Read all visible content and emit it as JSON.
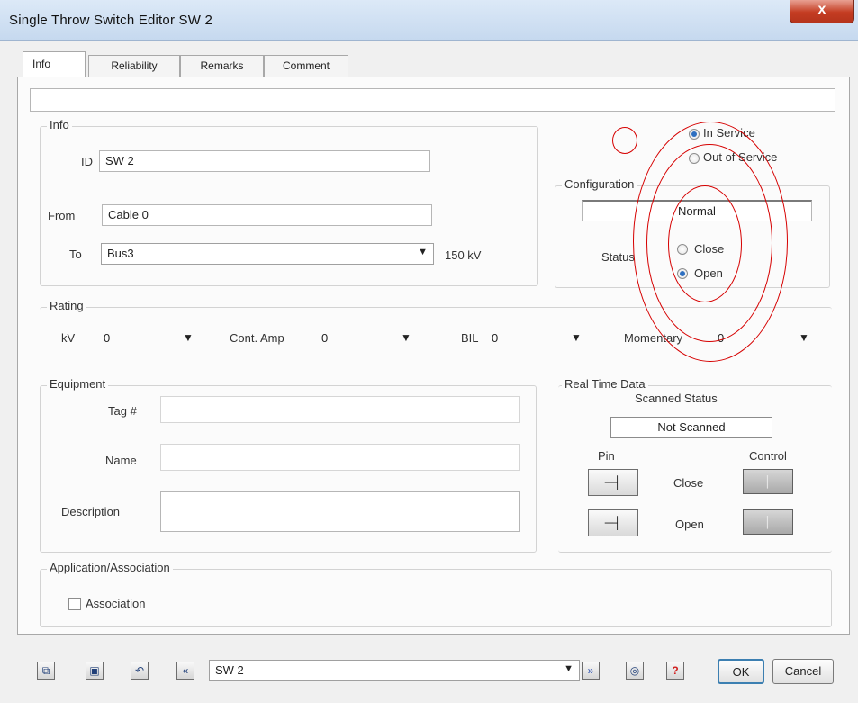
{
  "window": {
    "title": "Single Throw Switch Editor   SW 2",
    "close_glyph": "x"
  },
  "tabs": [
    {
      "label": "Info"
    },
    {
      "label": "Reliability"
    },
    {
      "label": "Remarks"
    },
    {
      "label": "Comment"
    }
  ],
  "top_field": {
    "value": ""
  },
  "info": {
    "group_label": "Info",
    "id_label": "ID",
    "id_value": "SW 2",
    "from_label": "From",
    "from_value": "Cable 0",
    "to_label": "To",
    "to_value": "Bus3",
    "to_kv": "150 kV"
  },
  "service": {
    "in_service": "In Service",
    "out_of_service": "Out of Service",
    "selected": "in_service"
  },
  "configuration": {
    "group_label": "Configuration",
    "value": "Normal",
    "status_label": "Status",
    "close_label": "Close",
    "open_label": "Open",
    "selected": "open"
  },
  "rating": {
    "group_label": "Rating",
    "kv_label": "kV",
    "kv_value": "0",
    "cont_amp_label": "Cont. Amp",
    "cont_amp_value": "0",
    "bil_label": "BIL",
    "bil_value": "0",
    "momentary_label": "Momentary",
    "momentary_value": "0"
  },
  "equipment": {
    "group_label": "Equipment",
    "tag_label": "Tag #",
    "tag_value": "",
    "name_label": "Name",
    "name_value": "",
    "description_label": "Description",
    "description_value": ""
  },
  "realtime": {
    "group_label": "Real Time Data",
    "scanned_status_label": "Scanned Status",
    "scanned_status_value": "Not Scanned",
    "pin_label": "Pin",
    "control_label": "Control",
    "close_label": "Close",
    "open_label": "Open",
    "pin_glyph": "─┤",
    "control_glyph": "│"
  },
  "application": {
    "group_label": "Application/Association",
    "association_label": "Association",
    "association_checked": false
  },
  "footer": {
    "navigator_value": "SW 2",
    "ok_label": "OK",
    "cancel_label": "Cancel",
    "icon_glyphs": {
      "copy": "⧉",
      "paste": "▣",
      "undo": "↶",
      "back": "«",
      "forward": "»",
      "find": "◎",
      "help": "?"
    }
  },
  "colors": {
    "annotation": "#d60000",
    "help_icon": "#d12020",
    "forward_icon": "#2a4fb0"
  }
}
